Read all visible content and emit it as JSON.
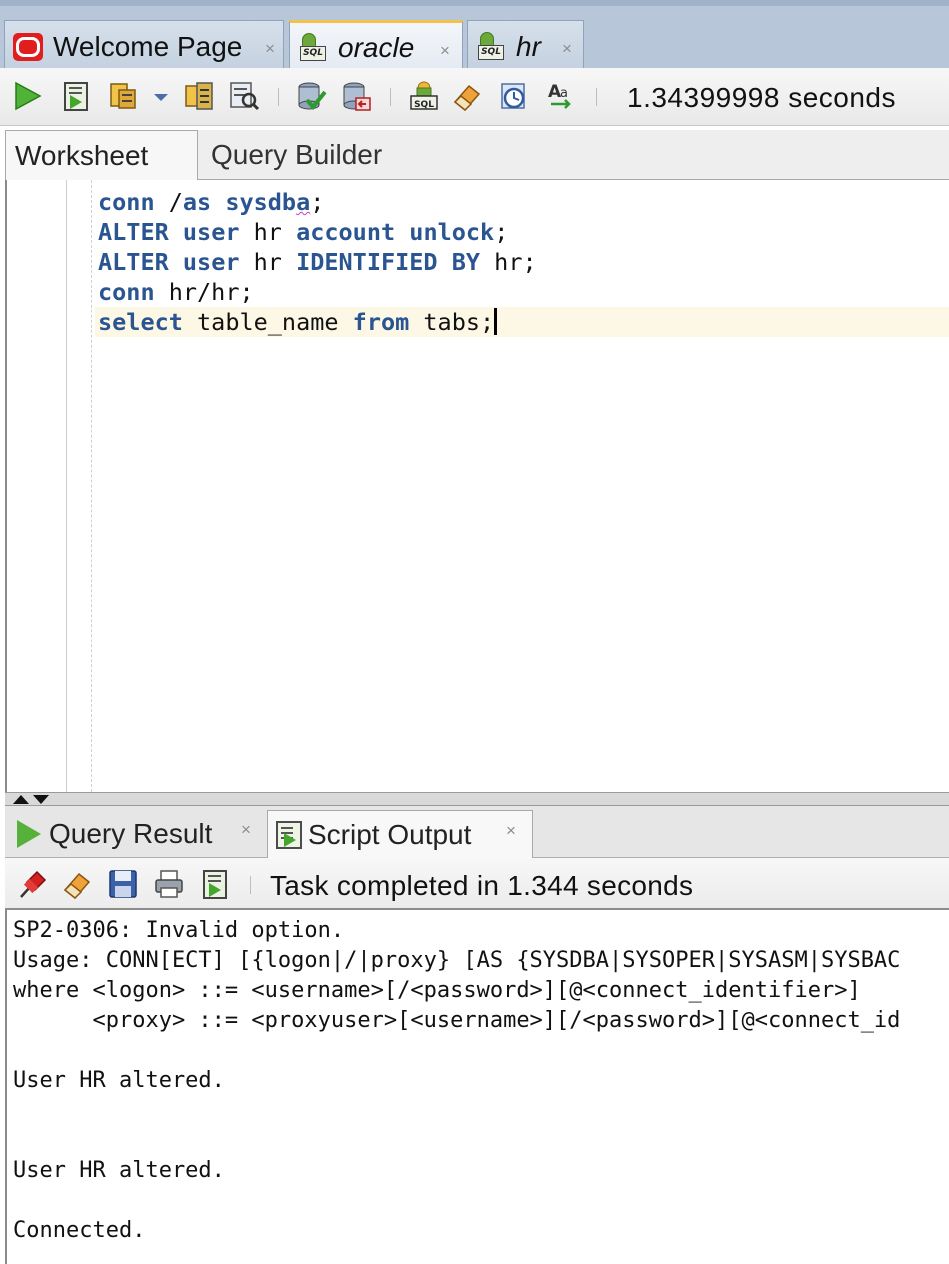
{
  "doc_tabs": [
    {
      "label": "Welcome Page",
      "close": "×",
      "icon": "oracle-logo-icon"
    },
    {
      "label": "oracle",
      "close": "×",
      "icon": "sql-connection-icon",
      "active": true
    },
    {
      "label": "hr",
      "close": "×",
      "icon": "sql-connection-icon"
    }
  ],
  "toolbar": {
    "elapsed": "1.34399998 seconds",
    "icons": [
      "run-statement-icon",
      "run-script-icon",
      "autotrace-icon",
      "dropdown-arrow-icon",
      "explain-plan-icon",
      "sql-tuning-icon",
      "commit-icon",
      "rollback-icon",
      "unshared-sql-icon",
      "clear-icon",
      "sql-history-icon",
      "format-case-icon"
    ]
  },
  "worksheet_tabs": {
    "worksheet": "Worksheet",
    "query_builder": "Query Builder"
  },
  "editor": {
    "lines": [
      {
        "parts": [
          {
            "t": "conn",
            "kw": true
          },
          {
            "t": " /"
          },
          {
            "t": "as",
            "kw": true
          },
          {
            "t": " "
          },
          {
            "t": "sysdb",
            "kw": true
          },
          {
            "t": "a",
            "kw": true,
            "squig": true
          },
          {
            "t": ";"
          }
        ]
      },
      {
        "parts": [
          {
            "t": "ALTER",
            "kw": true
          },
          {
            "t": " "
          },
          {
            "t": "user",
            "kw": true
          },
          {
            "t": " hr "
          },
          {
            "t": "account",
            "kw": true
          },
          {
            "t": " "
          },
          {
            "t": "unlock",
            "kw": true
          },
          {
            "t": ";"
          }
        ]
      },
      {
        "parts": [
          {
            "t": "ALTER",
            "kw": true
          },
          {
            "t": " "
          },
          {
            "t": "user",
            "kw": true
          },
          {
            "t": " hr "
          },
          {
            "t": "IDENTIFIED",
            "kw": true
          },
          {
            "t": " "
          },
          {
            "t": "BY",
            "kw": true
          },
          {
            "t": " hr;"
          }
        ]
      },
      {
        "parts": [
          {
            "t": "conn",
            "kw": true
          },
          {
            "t": " hr/hr;"
          }
        ]
      },
      {
        "parts": [
          {
            "t": "select",
            "kw": true
          },
          {
            "t": " table_name "
          },
          {
            "t": "from",
            "kw": true
          },
          {
            "t": " tabs;"
          }
        ],
        "current": true
      }
    ]
  },
  "output_tabs": {
    "query_result": "Query Result",
    "script_output": "Script Output",
    "close": "×"
  },
  "output_toolbar": {
    "status": "Task completed in 1.344 seconds",
    "icons": [
      "pin-icon",
      "eraser-icon",
      "save-icon",
      "print-icon",
      "script-icon"
    ]
  },
  "script_output": [
    "SP2-0306: Invalid option.",
    "Usage: CONN[ECT] [{logon|/|proxy} [AS {SYSDBA|SYSOPER|SYSASM|SYSBAC",
    "where <logon> ::= <username>[/<password>][@<connect_identifier>]",
    "      <proxy> ::= <proxyuser>[<username>][/<password>][@<connect_id",
    "",
    "User HR altered.",
    "",
    "",
    "User HR altered.",
    "",
    "Connected."
  ]
}
